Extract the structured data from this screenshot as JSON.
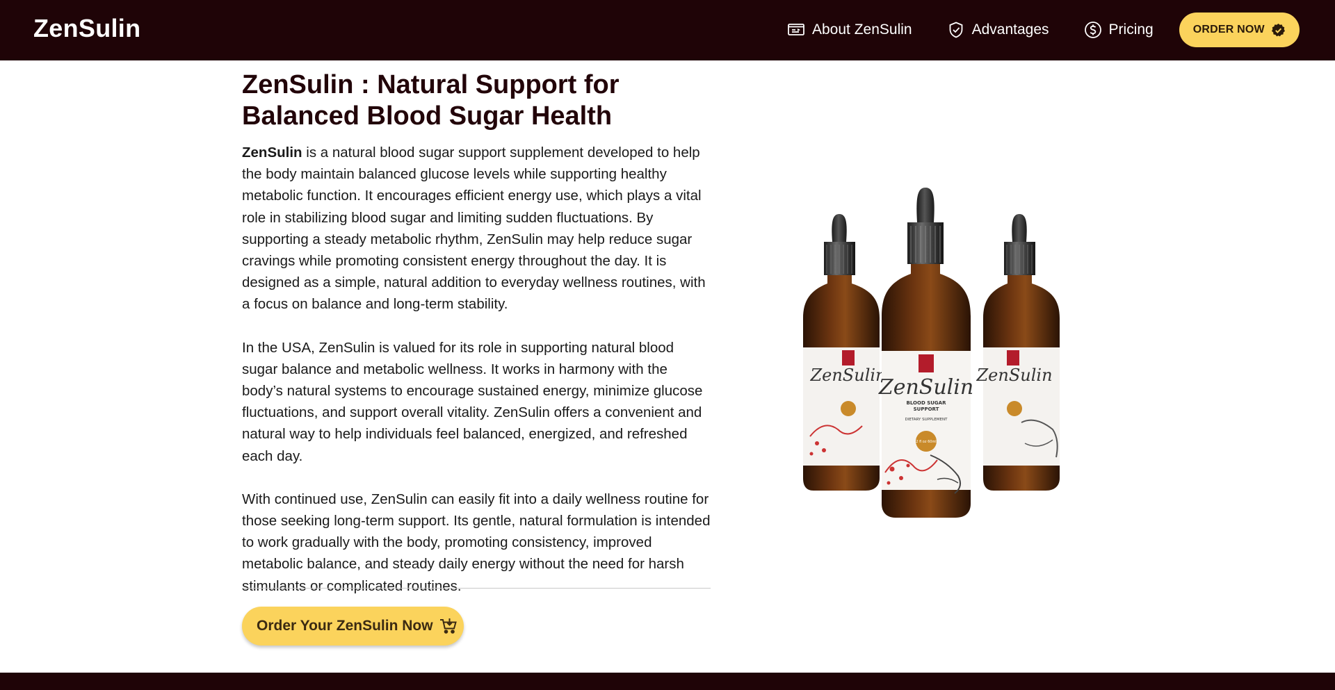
{
  "brand": "ZenSulin",
  "nav": {
    "items": [
      {
        "label": "About ZenSulin",
        "icon": "presentation-icon"
      },
      {
        "label": "Advantages",
        "icon": "shield-check-icon"
      },
      {
        "label": "Pricing",
        "icon": "dollar-circle-icon"
      }
    ],
    "order_label": "ORDER NOW"
  },
  "hero": {
    "title": "ZenSulin : Natural Support for Balanced Blood Sugar Health",
    "para1_bold": "ZenSulin",
    "para1_rest": " is a natural blood sugar support supplement developed to help the body maintain balanced glucose levels while supporting healthy metabolic function. It encourages efficient energy use, which plays a vital role in stabilizing blood sugar and limiting sudden fluctuations. By supporting a steady metabolic rhythm, ZenSulin may help reduce sugar cravings while promoting consistent energy throughout the day. It is designed as a simple, natural addition to everyday wellness routines, with a focus on balance and long-term stability.",
    "para2": "In the USA, ZenSulin is valued for its role in supporting natural blood sugar balance and metabolic wellness. It works in harmony with the body’s natural systems to encourage sustained energy, minimize glucose fluctuations, and support overall vitality. ZenSulin offers a convenient and natural way to help individuals feel balanced, energized, and refreshed each day.",
    "para3": "With continued use, ZenSulin can easily fit into a daily wellness routine for those seeking long-term support. Its gentle, natural formulation is intended to work gradually with the body, promoting consistency, improved metabolic balance, and steady daily energy without the need for harsh stimulants or complicated routines.",
    "cta_label": "Order Your ZenSulin Now"
  },
  "product": {
    "bottle_brand": "ZenSulin",
    "bottle_sub1": "BLOOD SUGAR",
    "bottle_sub2": "SUPPORT",
    "bottle_sub3": "DIETARY SUPPLEMENT",
    "bottle_volume": "2 fl oz 60ml"
  },
  "colors": {
    "nav_bg": "#1f0407",
    "accent_yellow": "#fbd35c",
    "title_color": "#220409"
  }
}
